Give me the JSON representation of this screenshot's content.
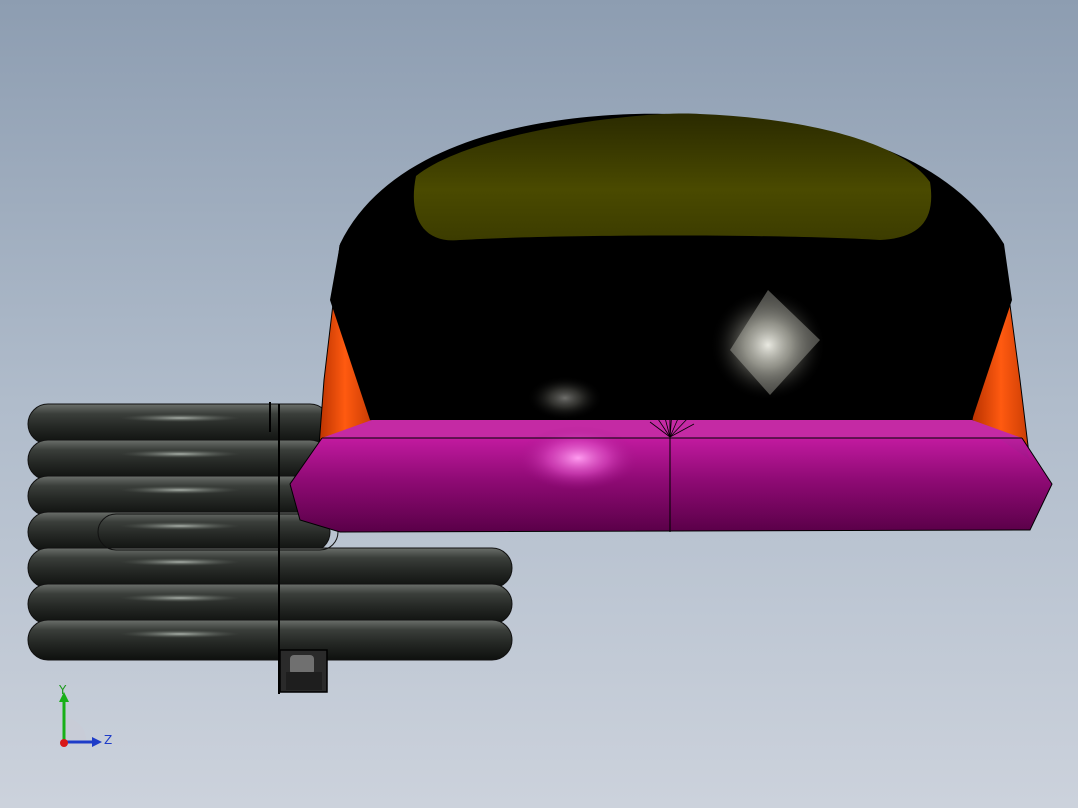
{
  "viewport": {
    "background_top": "#8d9db1",
    "background_bottom": "#ccd2dc"
  },
  "model": {
    "parts": [
      {
        "name": "dome-cap",
        "color": "#000000"
      },
      {
        "name": "dome-top-highlight",
        "color": "#4a4a00"
      },
      {
        "name": "side-fins",
        "color": "#e24a08"
      },
      {
        "name": "base-ring",
        "color": "#9a0a78"
      },
      {
        "name": "coil-spring",
        "color": "#2c302c"
      },
      {
        "name": "mount-bracket",
        "color": "#2a2a2a"
      }
    ]
  },
  "triad": {
    "y_label": "Y",
    "z_label": "Z",
    "y_color": "#18b018",
    "z_color": "#1e3cc8",
    "x_color": "#d81818",
    "icons": [
      "triad-y-axis-icon",
      "triad-z-axis-icon",
      "triad-x-axis-icon"
    ]
  }
}
